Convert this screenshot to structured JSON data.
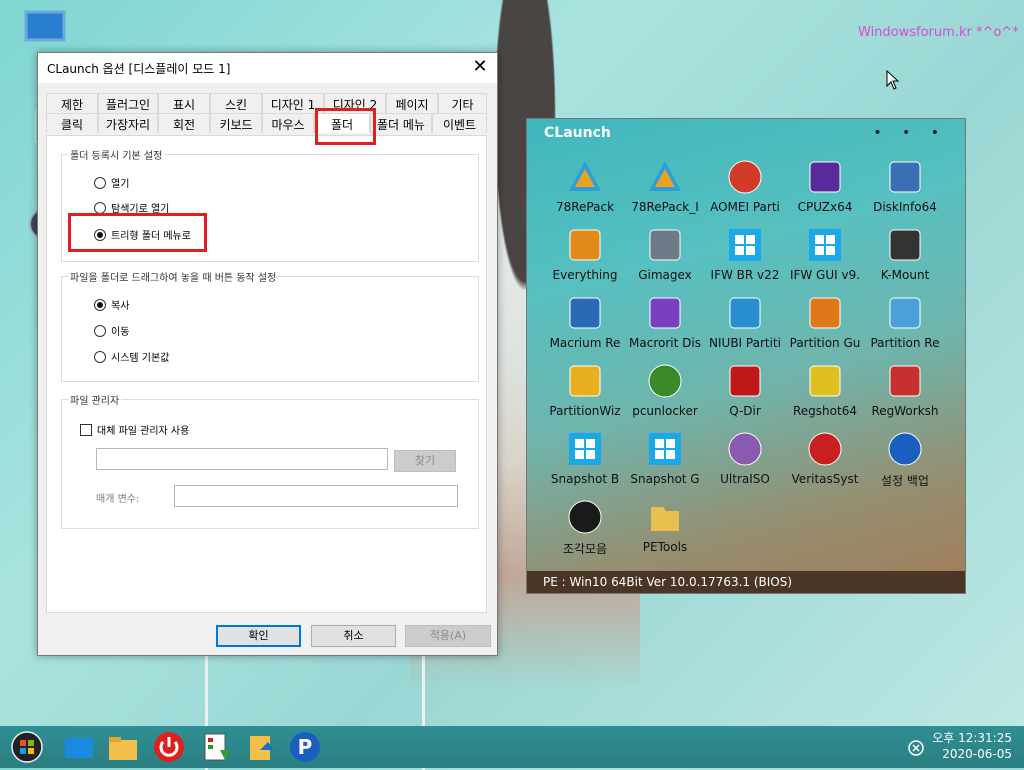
{
  "desktop": {
    "watermark": "Windowsforum.kr  *^o^*",
    "left_icons": [
      {
        "label": "",
        "icon": "monitor-icon"
      },
      {
        "label": "",
        "icon": "recycle-bin-icon"
      },
      {
        "label": "",
        "icon": "disk-icon"
      }
    ]
  },
  "dialog": {
    "title": "CLaunch 옵션 [디스플레이 모드 1]",
    "close_glyph": "✕",
    "tabs_row1": [
      "제한",
      "플러그인",
      "표시",
      "스킨",
      "디자인 1",
      "디자인 2",
      "페이지",
      "기타"
    ],
    "tabs_row2": [
      "클릭",
      "가장자리",
      "회전",
      "키보드",
      "마우스",
      "폴더",
      "폴더 메뉴",
      "이벤트"
    ],
    "active_tab": "폴더",
    "group1": {
      "legend": "폴더 등록시 기본 설정",
      "options": [
        "열기",
        "탐색기로 열기",
        "트리형 폴더 메뉴로"
      ],
      "selected": "트리형 폴더 메뉴로"
    },
    "group2": {
      "legend": "파일을 폴더로 드래그하여 놓을 때 버튼 동작 설정",
      "options": [
        "복사",
        "이동",
        "시스템 기본값"
      ],
      "selected": "복사"
    },
    "group3": {
      "legend": "파일 관리자",
      "checkbox_label": "대체 파일 관리자 사용",
      "checked": false,
      "path_value": "",
      "browse_label": "찾기",
      "param_label": "매개 변수:",
      "param_value": ""
    },
    "buttons": {
      "ok": "확인",
      "cancel": "취소",
      "apply": "적용(A)"
    }
  },
  "claunch": {
    "title": "CLaunch",
    "menu_dots": "• • •",
    "status": "PE : Win10 64Bit Ver 10.0.17763.1 (BIOS)",
    "apps": [
      {
        "label": "78RePack",
        "icon": "78repack-icon",
        "color": "#1a7fc8"
      },
      {
        "label": "78RePack_I",
        "icon": "78repack-installer-icon",
        "color": "#1a7fc8"
      },
      {
        "label": "AOMEI Parti",
        "icon": "aomei-partition-icon",
        "color": "#d23b2a"
      },
      {
        "label": "CPUZx64",
        "icon": "cpuz-icon",
        "color": "#5a2a9a"
      },
      {
        "label": "DiskInfo64",
        "icon": "diskinfo-icon",
        "color": "#3a6fb5"
      },
      {
        "label": "Everything",
        "icon": "everything-icon",
        "color": "#e08a1a"
      },
      {
        "label": "Gimagex",
        "icon": "gimagex-icon",
        "color": "#6f7a88"
      },
      {
        "label": "IFW BR v22",
        "icon": "windows-icon",
        "color": "#1aa8e8"
      },
      {
        "label": "IFW GUI v9.",
        "icon": "windows-icon",
        "color": "#1aa8e8"
      },
      {
        "label": "K-Mount",
        "icon": "kmount-icon",
        "color": "#333333"
      },
      {
        "label": "Macrium Re",
        "icon": "macrium-icon",
        "color": "#2a6ab5"
      },
      {
        "label": "Macrorit Dis",
        "icon": "macrorit-icon",
        "color": "#7a3fc0"
      },
      {
        "label": "NIUBI Partiti",
        "icon": "niubi-icon",
        "color": "#2a8fd0"
      },
      {
        "label": "Partition Gu",
        "icon": "partition-guru-icon",
        "color": "#e0781a"
      },
      {
        "label": "Partition Re",
        "icon": "partition-recovery-icon",
        "color": "#4aa0d8"
      },
      {
        "label": "PartitionWiz",
        "icon": "partitionwizard-icon",
        "color": "#e8b020"
      },
      {
        "label": "pcunlocker",
        "icon": "pcunlocker-icon",
        "color": "#3a8a2a"
      },
      {
        "label": "Q-Dir",
        "icon": "qdir-icon",
        "color": "#c01818"
      },
      {
        "label": "Regshot64",
        "icon": "regshot-icon",
        "color": "#e0c020"
      },
      {
        "label": "RegWorksh",
        "icon": "regworkshop-icon",
        "color": "#c83030"
      },
      {
        "label": "Snapshot B",
        "icon": "windows-icon",
        "color": "#1aa8e8"
      },
      {
        "label": "Snapshot G",
        "icon": "windows-icon",
        "color": "#1aa8e8"
      },
      {
        "label": "UltraISO",
        "icon": "ultraiso-icon",
        "color": "#8a5ab0"
      },
      {
        "label": "VeritasSyst",
        "icon": "veritas-icon",
        "color": "#c82020"
      },
      {
        "label": "설정 백업",
        "icon": "backup-settings-icon",
        "color": "#1a5fc0"
      },
      {
        "label": "조각모음",
        "icon": "defrag-icon",
        "color": "#1a1a1a"
      },
      {
        "label": "PETools",
        "icon": "folder-icon",
        "color": "#e8c050"
      }
    ]
  },
  "taskbar": {
    "items": [
      "start-icon",
      "desktop-icon",
      "explorer-icon",
      "power-icon",
      "task-manager-icon",
      "file-move-icon",
      "p-app-icon"
    ],
    "clock_time": "오후 12:31:25",
    "clock_date": "2020-06-05"
  }
}
